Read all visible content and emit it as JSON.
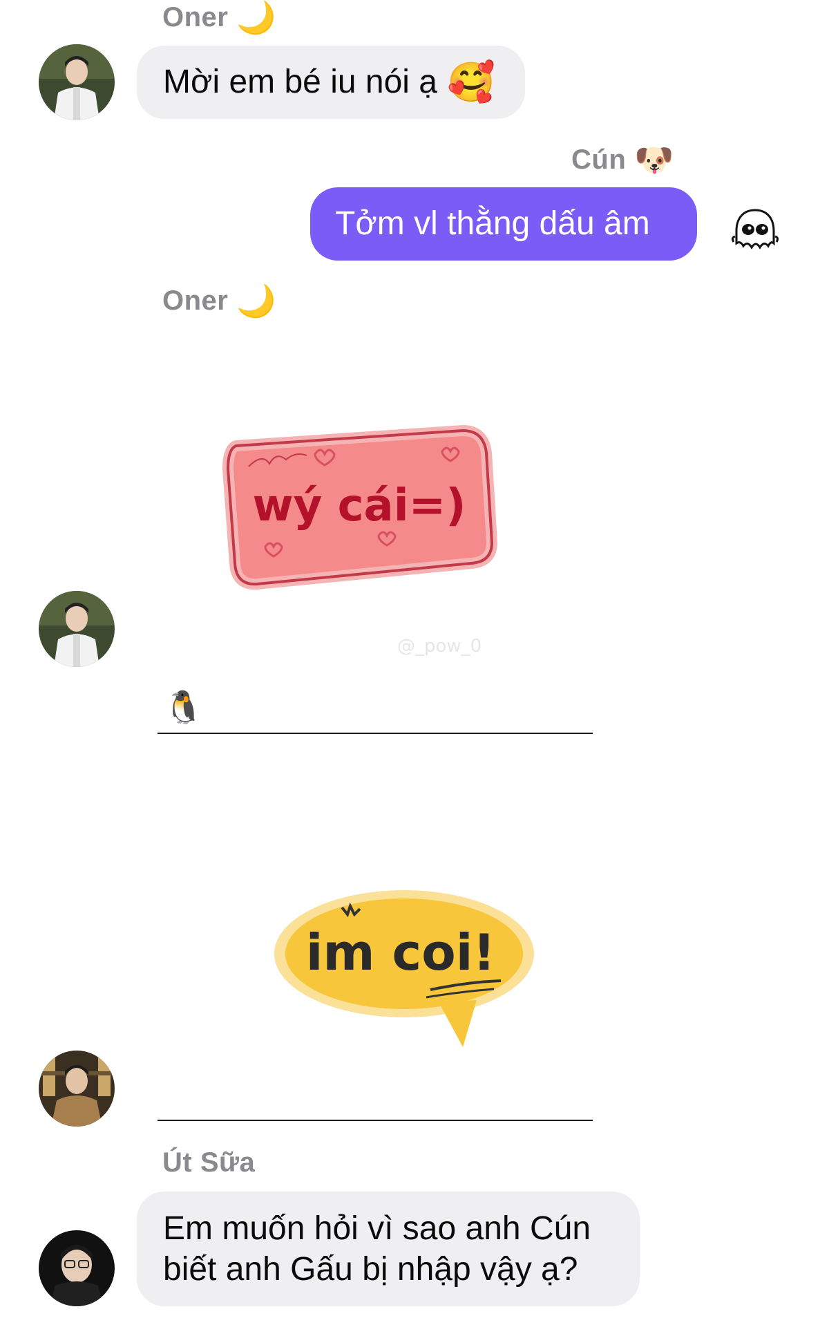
{
  "messages": [
    {
      "sender": "Oner",
      "sender_emoji": "🌙",
      "text": "Mời em bé iu nói ạ",
      "text_emoji": "🥰"
    },
    {
      "sender": "Cún",
      "sender_emoji": "🐶",
      "text": "Tởm vl thằng dấu âm"
    },
    {
      "sender": "Oner",
      "sender_emoji": "🌙",
      "sticker_text": "wý cái=)",
      "watermark": "@_pow_0"
    },
    {
      "reaction_emoji": "🐧",
      "sticker_text": "im coi!"
    },
    {
      "sender": "Út Sữa",
      "text_line1": "Em muốn hỏi vì sao anh Cún",
      "text_line2": "biết anh Gấu bị nhập vậy ạ?"
    }
  ],
  "colors": {
    "outgoing_bubble": "#7b5cf7",
    "incoming_bubble": "#efeff1",
    "sender_name": "#8a8a8e"
  }
}
